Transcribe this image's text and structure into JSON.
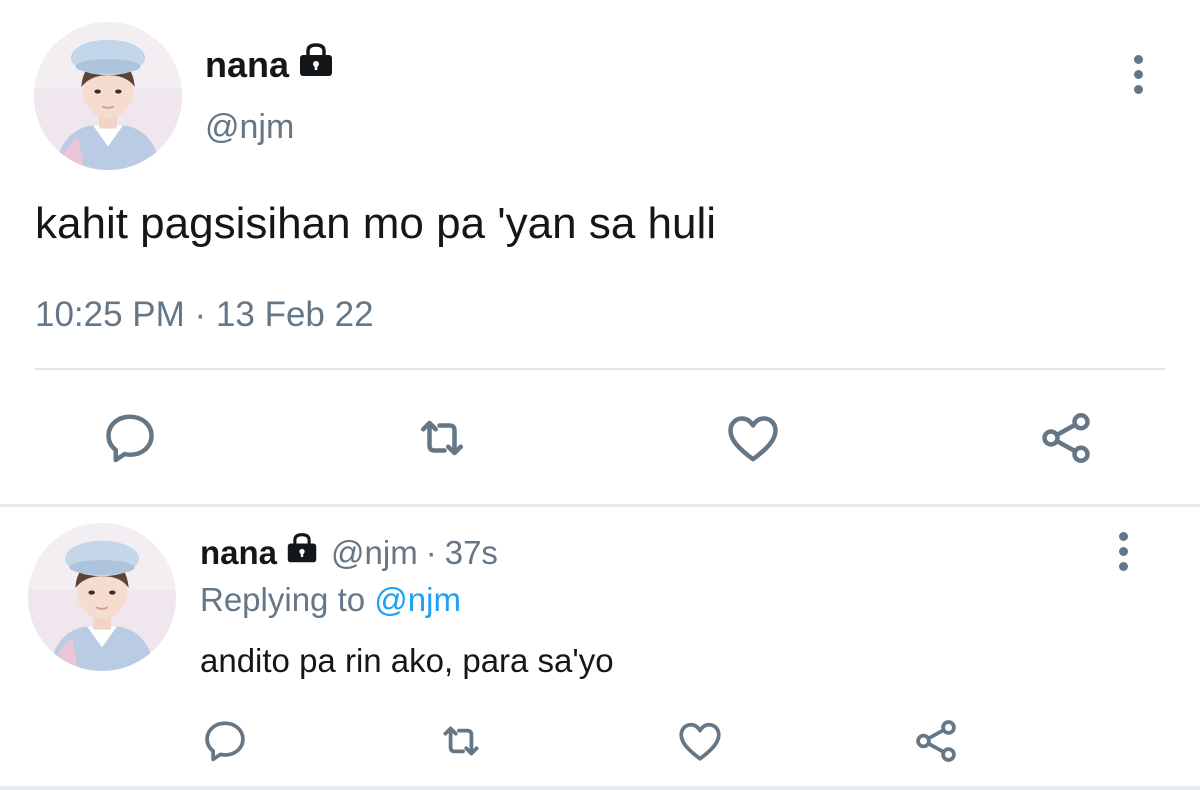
{
  "main_tweet": {
    "display_name": "nana",
    "handle": "@njm",
    "text": "kahit pagsisihan mo pa 'yan sa huli",
    "timestamp": "10:25 PM · 13 Feb 22",
    "icons": {
      "lock": "lock-icon",
      "more": "more-vertical-icon",
      "reply": "comment-icon",
      "retweet": "retweet-icon",
      "like": "heart-icon",
      "share": "share-icon"
    }
  },
  "reply_tweet": {
    "display_name": "nana",
    "handle": "@njm",
    "separator": "·",
    "time": "37s",
    "replying_prefix": "Replying to",
    "replying_to": "@njm",
    "text": "andito pa rin ako, para sa'yo"
  },
  "colors": {
    "primary_text": "#14171a",
    "secondary_text": "#657786",
    "accent": "#1da1f2",
    "divider": "#e1e8ed"
  }
}
